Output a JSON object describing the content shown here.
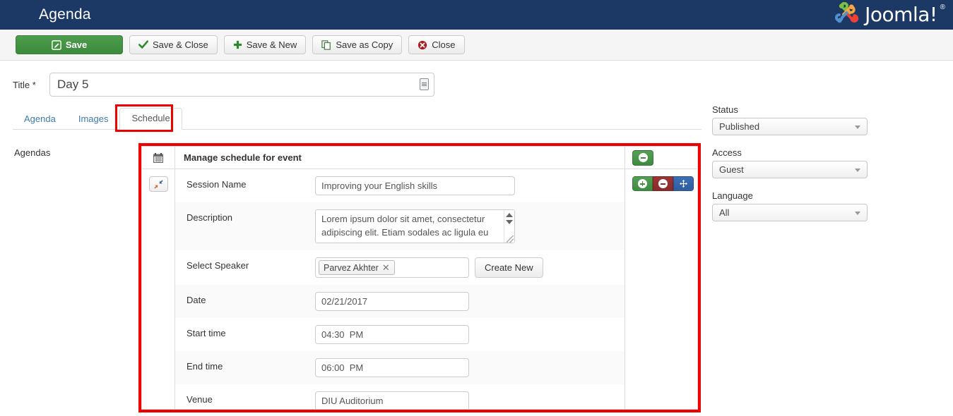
{
  "header": {
    "title": "Agenda",
    "brand": "Joomla!",
    "brand_reg": "®",
    "bg_color": "#1c3864"
  },
  "toolbar": {
    "buttons": [
      {
        "label": "Save",
        "icon": "edit-square-icon",
        "style": "primary"
      },
      {
        "label": "Save & Close",
        "icon": "check-icon",
        "style": "default"
      },
      {
        "label": "Save & New",
        "icon": "plus-icon",
        "style": "default"
      },
      {
        "label": "Save as Copy",
        "icon": "copy-icon",
        "style": "default"
      },
      {
        "label": "Close",
        "icon": "close-circle-icon",
        "style": "default"
      }
    ]
  },
  "title_field": {
    "label": "Title *",
    "value": "Day 5",
    "placeholder": "",
    "icon": "article-icon"
  },
  "tabs": [
    {
      "label": "Agenda",
      "active": false
    },
    {
      "label": "Images",
      "active": false
    },
    {
      "label": "Schedule",
      "active": true
    }
  ],
  "highlight_color": "#ee0000",
  "agendas_label": "Agendas",
  "schedule_panel": {
    "head_icon": "calendar-icon",
    "head_title": "Manage schedule for event",
    "head_add_button": "add-row-button",
    "collapse_button": "collapse-icon",
    "row_actions": [
      {
        "name": "add-item-button",
        "icon": "plus-icon",
        "color": "#3f8b3f"
      },
      {
        "name": "remove-item-button",
        "icon": "minus-icon",
        "color": "#8b2a2a"
      },
      {
        "name": "move-item-button",
        "icon": "move-icon",
        "color": "#2f5d9e"
      }
    ],
    "fields": [
      {
        "label": "Session Name",
        "value": "Improving your English skills",
        "type": "text"
      },
      {
        "label": "Description",
        "value": "Lorem ipsum dolor sit amet, consectetur adipiscing elit. Etiam sodales ac ligula eu",
        "type": "textarea"
      },
      {
        "label": "Select Speaker",
        "value": "Parvez Akhter",
        "type": "chips",
        "button_label": "Create New"
      },
      {
        "label": "Date",
        "value": "02/21/2017",
        "type": "text"
      },
      {
        "label": "Start time",
        "value": "04:30  PM",
        "type": "text"
      },
      {
        "label": "End time",
        "value": "06:00  PM",
        "type": "text"
      },
      {
        "label": "Venue",
        "value": "DIU Auditorium",
        "type": "text"
      }
    ]
  },
  "sidebar": {
    "groups": [
      {
        "label": "Status",
        "value": "Published"
      },
      {
        "label": "Access",
        "value": "Guest"
      },
      {
        "label": "Language",
        "value": "All"
      }
    ]
  }
}
